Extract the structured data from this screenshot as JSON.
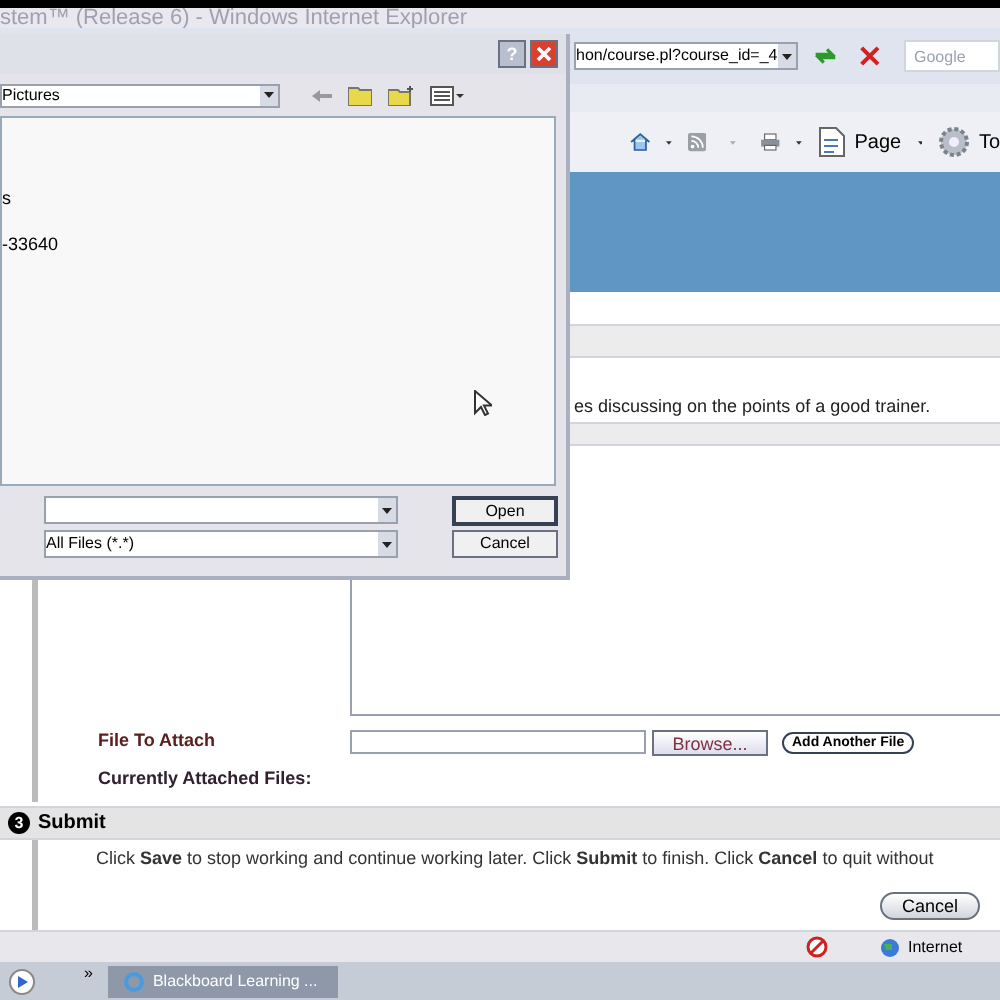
{
  "browser": {
    "title": "stem™ (Release 6) - Windows Internet Explorer",
    "address": "hon/course.pl?course_id=_4",
    "search_placeholder": "Google",
    "toolbar": [
      {
        "kind": "home"
      },
      {
        "kind": "feed"
      },
      {
        "kind": "print"
      },
      {
        "kind": "page",
        "label": "Page"
      },
      {
        "kind": "tools",
        "label": "To"
      }
    ]
  },
  "page": {
    "description": "es discussing on the points of a good trainer.",
    "file_label": "File To Attach",
    "browse": "Browse...",
    "add_file": "Add Another File",
    "attached_label": "Currently Attached Files:",
    "step_number": "3",
    "step_title": "Submit",
    "instructions": "Click **Save** to stop working and continue working later. Click **Submit** to finish. Click **Cancel** to quit without",
    "buttons": [
      "Cancel"
    ]
  },
  "status_bar": {
    "zone": "Internet"
  },
  "taskbar": {
    "chevron": "»",
    "task": "Blackboard Learning ..."
  },
  "dialog": {
    "look_in": "Pictures",
    "files": [
      {
        "name": "s"
      },
      {
        "name": "-33640"
      }
    ],
    "file_type": "All Files (*.*)",
    "open": "Open",
    "cancel": "Cancel",
    "help": "?"
  }
}
